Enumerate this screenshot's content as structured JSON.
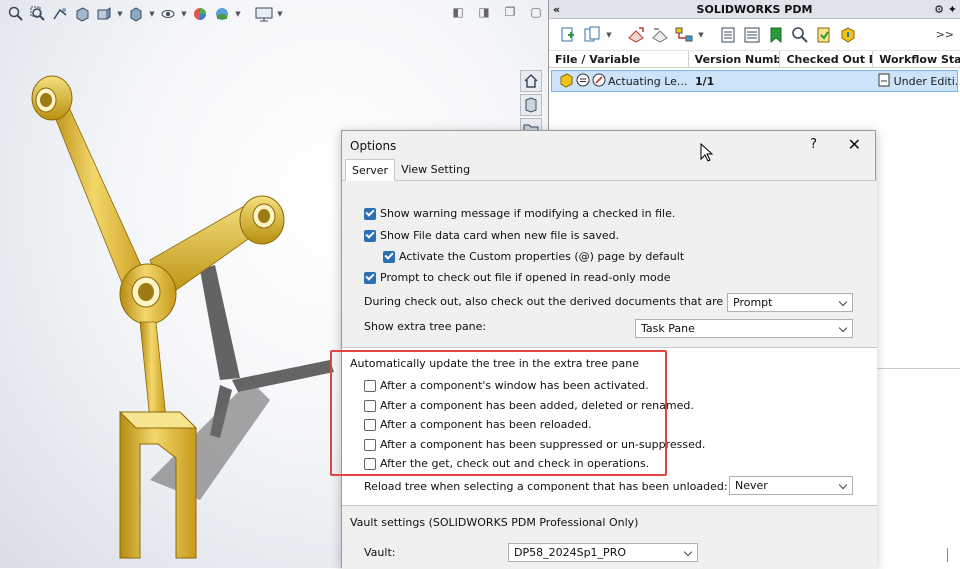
{
  "viewport": {
    "toolbar_icons": [
      "zoom-to-fit-icon",
      "zoom-area-icon",
      "previous-view-icon",
      "section-view-icon",
      "view-orientation-icon",
      "display-style-icon",
      "hide-show-icon",
      "edit-appearance-icon",
      "apply-scene-icon",
      "view-settings-icon"
    ],
    "window_controls": [
      "restore-icon",
      "maximize-icon",
      "minimize-icon",
      "close-icon"
    ]
  },
  "pdm": {
    "title": "SOLIDWORKS PDM",
    "more": ">>",
    "columns": [
      "File / Variable",
      "Version Number",
      "Checked Out By",
      "Workflow State"
    ],
    "row": {
      "name": "Actuating Le...",
      "version": "1/1",
      "checked_out_by": "",
      "workflow_state": "Under Editi..."
    }
  },
  "dialog": {
    "title": "Options",
    "help": "?",
    "close": "✕",
    "tabs": [
      "Server",
      "View Setting"
    ],
    "opt_warning": "Show warning message if modifying a checked in file.",
    "opt_datacard": "Show File data card when new file is saved.",
    "opt_custom": "Activate the Custom properties (@) page by default",
    "opt_prompt": "Prompt to check out file if opened in read-only mode",
    "derived_label": "During check out, also check out the derived documents that are opened:",
    "derived_value": "Prompt",
    "extra_label": "Show extra tree pane:",
    "extra_value": "Task Pane",
    "auto_title": "Automatically update the tree in the extra tree pane",
    "auto_1": "After a component's window has been activated.",
    "auto_2": "After a component has been added, deleted or renamed.",
    "auto_3": "After a component has been reloaded.",
    "auto_4": "After a component has been suppressed or un-suppressed.",
    "auto_5": "After the get, check out and check in operations.",
    "reload_label": "Reload tree when selecting a component that has been unloaded:",
    "reload_value": "Never",
    "vault_title": "Vault settings (SOLIDWORKS PDM Professional Only)",
    "vault_label": "Vault:",
    "vault_value": "DP58_2024Sp1_PRO"
  },
  "colors": {
    "accent": "#2b6fb5",
    "highlight": "#e0463f",
    "part": "#e8c437",
    "selection": "#cce3fa"
  }
}
